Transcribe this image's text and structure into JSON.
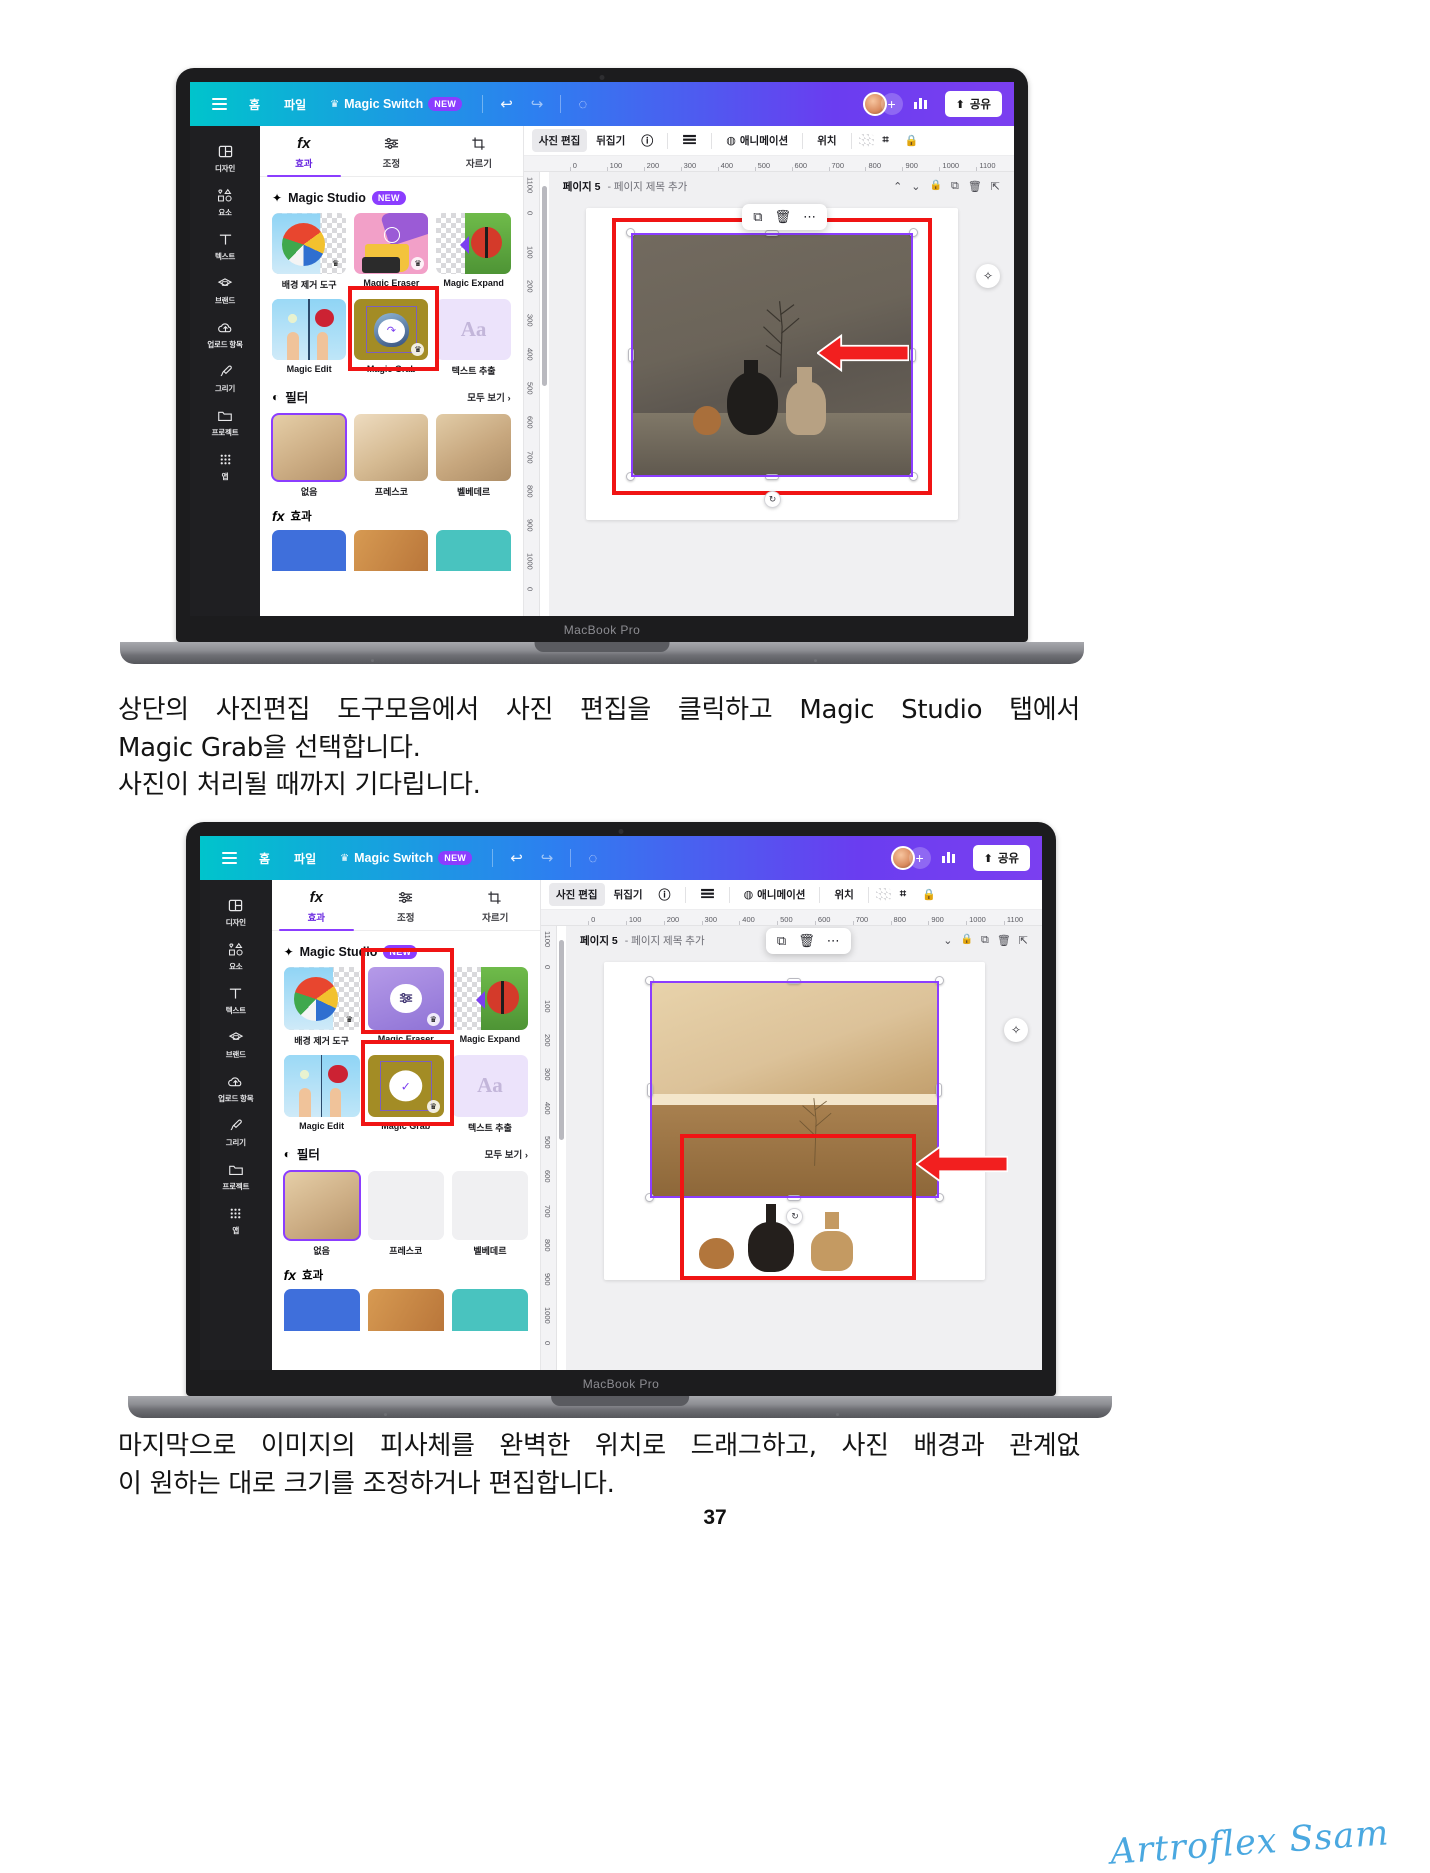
{
  "document": {
    "page_number": "37",
    "signature": "Artroflex Ssam",
    "caption_top_line1": "상단의 사진편집 도구모음에서 사진 편집을 클릭하고 Magic Studio 탭에서",
    "caption_top_line2": "Magic Grab을 선택합니다.",
    "caption_top_line3": "사진이 처리될 때까지 기다립니다.",
    "caption_bottom_line1": "마지막으로 이미지의 피사체를 완벽한 위치로 드래그하고, 사진 배경과 관계없",
    "caption_bottom_line2": "이 원하는 대로 크기를 조정하거나 편집합니다."
  },
  "laptop": {
    "model_label": "MacBook Pro"
  },
  "app": {
    "topbar": {
      "menu_icon": "hamburger-icon",
      "home": "홈",
      "file": "파일",
      "magic_switch": "Magic Switch",
      "magic_switch_badge": "NEW",
      "undo_icon": "undo-icon",
      "redo_icon": "redo-icon",
      "cloud_icon": "cloud-check-icon",
      "avatar": "avatar",
      "plus": "+",
      "stats_icon": "bar-chart-icon",
      "share_icon": "upload-icon",
      "share_label": "공유"
    },
    "rail": [
      {
        "label": "디자인",
        "icon": "layout-icon"
      },
      {
        "label": "요소",
        "icon": "shapes-icon"
      },
      {
        "label": "텍스트",
        "icon": "text-icon"
      },
      {
        "label": "브랜드",
        "icon": "brand-icon"
      },
      {
        "label": "업로드 항목",
        "icon": "cloud-upload-icon"
      },
      {
        "label": "그리기",
        "icon": "pen-icon"
      },
      {
        "label": "프로젝트",
        "icon": "folder-icon"
      },
      {
        "label": "앱",
        "icon": "apps-grid-icon"
      }
    ],
    "panel_tabs": [
      {
        "label": "효과",
        "icon": "fx-icon",
        "active": true
      },
      {
        "label": "조정",
        "icon": "sliders-icon",
        "active": false
      },
      {
        "label": "자르기",
        "icon": "crop-icon",
        "active": false
      }
    ],
    "magic_studio": {
      "title": "Magic Studio",
      "badge": "NEW",
      "sparkle_icon": "sparkle-icon",
      "tiles": [
        {
          "label": "배경 제거 도구",
          "icon": "beachball-thumb"
        },
        {
          "label": "Magic Eraser",
          "icon": "fries-thumb"
        },
        {
          "label": "Magic Expand",
          "icon": "ladybug-thumb"
        },
        {
          "label": "Magic Edit",
          "icon": "flowers-thumb"
        },
        {
          "label": "Magic Grab",
          "icon": "grab-thumb"
        },
        {
          "label": "텍스트 추출",
          "icon": "aa-thumb"
        }
      ]
    },
    "filter_section": {
      "title": "필터",
      "icon": "filter-circles-icon",
      "see_all": "모두 보기",
      "chevron": "›",
      "items": [
        {
          "label": "없음",
          "selected": true
        },
        {
          "label": "프레스코",
          "selected": false
        },
        {
          "label": "벨베데르",
          "selected": false
        }
      ]
    },
    "fx_section": {
      "icon": "fx-icon",
      "title": "효과"
    },
    "context_bar": {
      "photo_edit": "사진 편집",
      "flip": "뒤집기",
      "info_icon": "info-icon",
      "align_icon": "align-icon",
      "animate_icon": "animate-icon",
      "animate": "애니메이션",
      "position": "위치",
      "transparency_icon": "transparency-icon",
      "crop_icon": "crop-icon",
      "lock_icon": "lock-icon"
    },
    "ruler": {
      "h_ticks": [
        "0",
        "100",
        "200",
        "300",
        "400",
        "500",
        "600",
        "700",
        "800",
        "900",
        "1000",
        "1100"
      ],
      "v_ticks": [
        "1100",
        "0",
        "100",
        "200",
        "300",
        "400",
        "500",
        "600",
        "700",
        "800",
        "900",
        "1000",
        "0"
      ]
    },
    "page_header": {
      "page_title_strong": "페이지 5",
      "page_title_dim": "- 페이지 제목 추가",
      "up_icon": "chevron-up-icon",
      "down_icon": "chevron-down-icon",
      "lock_icon": "lock-icon",
      "duplicate_icon": "duplicate-icon",
      "delete_icon": "trash-icon",
      "expand_icon": "expand-icon"
    },
    "float_toolbar": {
      "duplicate_icon": "duplicate-icon",
      "delete_icon": "trash-icon",
      "more_icon": "more-dots-icon"
    },
    "canvas": {
      "rotate_icon": "rotate-icon",
      "magic_icon": "magic-wand-icon",
      "arrow_icon": "red-arrow-left-icon"
    }
  },
  "colors": {
    "brand_teal": "#00c4cc",
    "brand_blue": "#2d7ff0",
    "brand_purple": "#7b3ff0",
    "accent_purple": "#8b3dff",
    "highlight_red": "#f01414",
    "rail_dark": "#1f1f22",
    "signature_blue": "#4aa8e0"
  }
}
